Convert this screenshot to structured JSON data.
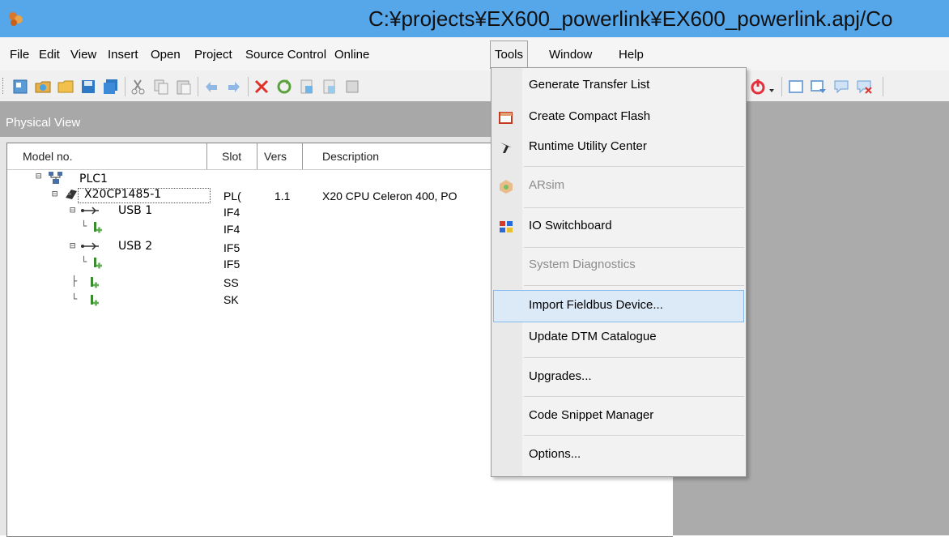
{
  "window": {
    "title": "C:¥projects¥EX600_powerlink¥EX600_powerlink.apj/Co",
    "app_icon": "automation-studio-icon"
  },
  "menubar": {
    "items": [
      {
        "label": "File"
      },
      {
        "label": "Edit"
      },
      {
        "label": "View"
      },
      {
        "label": "Insert"
      },
      {
        "label": "Open"
      },
      {
        "label": "Project"
      },
      {
        "label": "Source Control"
      },
      {
        "label": "Online"
      },
      {
        "label": "Tools",
        "active": true
      },
      {
        "label": "Window"
      },
      {
        "label": "Help"
      }
    ]
  },
  "toolbar": {
    "icons": [
      "new-icon",
      "open-icon",
      "open-folder-icon",
      "save-icon",
      "save-all-icon",
      "cut-icon",
      "copy-icon",
      "paste-icon",
      "undo-icon",
      "redo-icon",
      "delete-icon",
      "refresh-icon",
      "doc-icon",
      "doc2-icon",
      "properties-icon",
      "power-icon",
      "dropdown-arrow-icon",
      "window-icon",
      "window-arrow-icon",
      "comment-icon",
      "comment-delete-icon"
    ]
  },
  "physical_view": {
    "title": "Physical View",
    "columns": [
      "Model no.",
      "Slot",
      "Vers",
      "Description"
    ],
    "rows": [
      {
        "name": "PLC1",
        "slot": "",
        "vers": "",
        "desc": ""
      },
      {
        "name": "X20CP1485-1",
        "slot": "PL(",
        "vers": "1.1",
        "desc": "X20 CPU Celeron 400, PO"
      },
      {
        "name": "USB 1",
        "slot": "IF4",
        "vers": "",
        "desc": ""
      },
      {
        "name": "",
        "slot": "IF4",
        "vers": "",
        "desc": ""
      },
      {
        "name": "USB 2",
        "slot": "IF5",
        "vers": "",
        "desc": ""
      },
      {
        "name": "",
        "slot": "IF5",
        "vers": "",
        "desc": ""
      },
      {
        "name": "",
        "slot": "SS",
        "vers": "",
        "desc": ""
      },
      {
        "name": "",
        "slot": "SK",
        "vers": "",
        "desc": ""
      }
    ]
  },
  "tools_menu": {
    "items": [
      {
        "label": "Generate Transfer List",
        "enabled": true,
        "icon": ""
      },
      {
        "label": "Create Compact Flash",
        "enabled": true,
        "icon": "compact-flash-icon"
      },
      {
        "label": "Runtime Utility Center",
        "enabled": true,
        "icon": "runtime-utility-icon"
      },
      {
        "label": "ARsim",
        "enabled": false,
        "icon": "arsim-icon"
      },
      {
        "label": "IO Switchboard",
        "enabled": true,
        "icon": "io-switchboard-icon"
      },
      {
        "label": "System Diagnostics",
        "enabled": false,
        "icon": ""
      },
      {
        "label": "Import Fieldbus Device...",
        "enabled": true,
        "icon": "",
        "highlighted": true
      },
      {
        "label": "Update DTM Catalogue",
        "enabled": true,
        "icon": ""
      },
      {
        "label": "Upgrades...",
        "enabled": true,
        "icon": ""
      },
      {
        "label": "Code Snippet Manager",
        "enabled": true,
        "icon": ""
      },
      {
        "label": "Options...",
        "enabled": true,
        "icon": ""
      }
    ]
  },
  "colors": {
    "titlebar": "#56a6ea",
    "menu_highlight": "#dceaf8",
    "panel_header": "#a8a8a8"
  }
}
